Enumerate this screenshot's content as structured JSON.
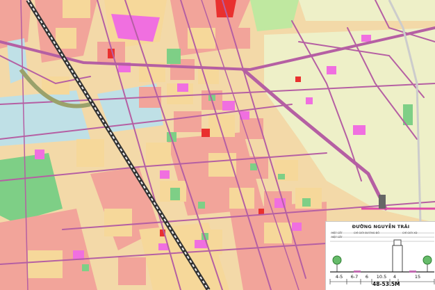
{
  "legend_panel": {
    "title": "ĐƯỜNG NGUYỄN TRÃI",
    "section_labels": [
      "MẶT CẮT",
      "MẶT CẮT",
      "CHỈ GIỚI ĐƯỜNG ĐỎ",
      "CHỈ GIỚI XD"
    ],
    "dimensions": [
      "4-5",
      "6-7",
      "6",
      "10.5",
      "4",
      "15"
    ],
    "total_width": "48-53.5M"
  },
  "colors": {
    "residential": "#f2a49a",
    "low_residential": "#f6d89a",
    "public": "#f06fe0",
    "green": "#7ecf86",
    "water": "#bfe0e6",
    "villa": "#eef0c8",
    "road": "#c06ab0",
    "rail": "#333333"
  }
}
